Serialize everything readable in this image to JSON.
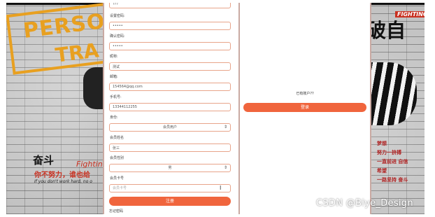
{
  "register": {
    "top_input_value": "???",
    "password_label": "设置密码:",
    "password_value": "•••••",
    "confirm_label": "确认密码:",
    "confirm_value": "•••••",
    "nickname_label": "昵称:",
    "nickname_value": "测试",
    "email_label": "邮箱:",
    "email_value": "154564@qq.com",
    "phone_label": "手机号:",
    "phone_value": "13344112255",
    "identity_label": "身份:",
    "identity_value": "会员用户",
    "member_name_label": "会员姓名",
    "member_name_value": "张三",
    "member_gender_label": "会员性别",
    "member_gender_value": "男",
    "member_card_label": "会员卡号",
    "member_card_placeholder": "会员卡号",
    "register_button": "注册",
    "forgot_link": "忘记密码"
  },
  "login": {
    "have_account_text": "已有账户??",
    "login_button": "登录"
  },
  "background": {
    "person_text": "PERSO",
    "trai_text": "TRA",
    "fendou_text": "奋斗",
    "fighting_text": "Fighting",
    "slogan_cn": "你不努力，谁也给",
    "slogan_en": "If you don't work hard, no o",
    "right_title": "破自",
    "right_fighting": "FIGHTING",
    "red_text_1": "梦想",
    "red_text_2": "努力一拚搏",
    "red_text_3": "一直前进 自信",
    "red_text_4": "希望",
    "red_text_5": "一路坚持 奋斗"
  },
  "watermark": "CSDN @Biye_Design",
  "colors": {
    "accent": "#f0653d",
    "input_border": "#e8a48a",
    "brand_orange": "#e8a020",
    "deco_red": "#c83020"
  }
}
